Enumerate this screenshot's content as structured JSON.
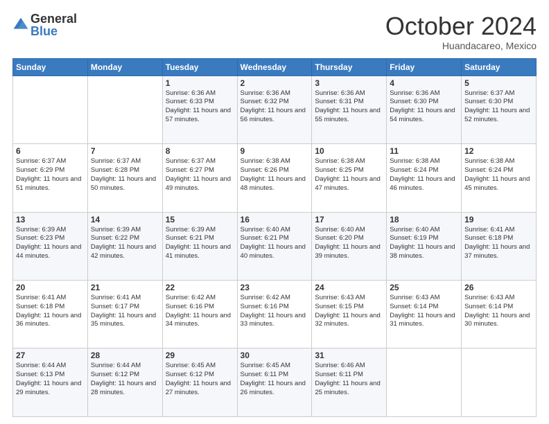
{
  "logo": {
    "general": "General",
    "blue": "Blue"
  },
  "title": "October 2024",
  "location": "Huandacareo, Mexico",
  "days_of_week": [
    "Sunday",
    "Monday",
    "Tuesday",
    "Wednesday",
    "Thursday",
    "Friday",
    "Saturday"
  ],
  "weeks": [
    [
      {
        "day": "",
        "sunrise": "",
        "sunset": "",
        "daylight": ""
      },
      {
        "day": "",
        "sunrise": "",
        "sunset": "",
        "daylight": ""
      },
      {
        "day": "1",
        "sunrise": "Sunrise: 6:36 AM",
        "sunset": "Sunset: 6:33 PM",
        "daylight": "Daylight: 11 hours and 57 minutes."
      },
      {
        "day": "2",
        "sunrise": "Sunrise: 6:36 AM",
        "sunset": "Sunset: 6:32 PM",
        "daylight": "Daylight: 11 hours and 56 minutes."
      },
      {
        "day": "3",
        "sunrise": "Sunrise: 6:36 AM",
        "sunset": "Sunset: 6:31 PM",
        "daylight": "Daylight: 11 hours and 55 minutes."
      },
      {
        "day": "4",
        "sunrise": "Sunrise: 6:36 AM",
        "sunset": "Sunset: 6:30 PM",
        "daylight": "Daylight: 11 hours and 54 minutes."
      },
      {
        "day": "5",
        "sunrise": "Sunrise: 6:37 AM",
        "sunset": "Sunset: 6:30 PM",
        "daylight": "Daylight: 11 hours and 52 minutes."
      }
    ],
    [
      {
        "day": "6",
        "sunrise": "Sunrise: 6:37 AM",
        "sunset": "Sunset: 6:29 PM",
        "daylight": "Daylight: 11 hours and 51 minutes."
      },
      {
        "day": "7",
        "sunrise": "Sunrise: 6:37 AM",
        "sunset": "Sunset: 6:28 PM",
        "daylight": "Daylight: 11 hours and 50 minutes."
      },
      {
        "day": "8",
        "sunrise": "Sunrise: 6:37 AM",
        "sunset": "Sunset: 6:27 PM",
        "daylight": "Daylight: 11 hours and 49 minutes."
      },
      {
        "day": "9",
        "sunrise": "Sunrise: 6:38 AM",
        "sunset": "Sunset: 6:26 PM",
        "daylight": "Daylight: 11 hours and 48 minutes."
      },
      {
        "day": "10",
        "sunrise": "Sunrise: 6:38 AM",
        "sunset": "Sunset: 6:25 PM",
        "daylight": "Daylight: 11 hours and 47 minutes."
      },
      {
        "day": "11",
        "sunrise": "Sunrise: 6:38 AM",
        "sunset": "Sunset: 6:24 PM",
        "daylight": "Daylight: 11 hours and 46 minutes."
      },
      {
        "day": "12",
        "sunrise": "Sunrise: 6:38 AM",
        "sunset": "Sunset: 6:24 PM",
        "daylight": "Daylight: 11 hours and 45 minutes."
      }
    ],
    [
      {
        "day": "13",
        "sunrise": "Sunrise: 6:39 AM",
        "sunset": "Sunset: 6:23 PM",
        "daylight": "Daylight: 11 hours and 44 minutes."
      },
      {
        "day": "14",
        "sunrise": "Sunrise: 6:39 AM",
        "sunset": "Sunset: 6:22 PM",
        "daylight": "Daylight: 11 hours and 42 minutes."
      },
      {
        "day": "15",
        "sunrise": "Sunrise: 6:39 AM",
        "sunset": "Sunset: 6:21 PM",
        "daylight": "Daylight: 11 hours and 41 minutes."
      },
      {
        "day": "16",
        "sunrise": "Sunrise: 6:40 AM",
        "sunset": "Sunset: 6:21 PM",
        "daylight": "Daylight: 11 hours and 40 minutes."
      },
      {
        "day": "17",
        "sunrise": "Sunrise: 6:40 AM",
        "sunset": "Sunset: 6:20 PM",
        "daylight": "Daylight: 11 hours and 39 minutes."
      },
      {
        "day": "18",
        "sunrise": "Sunrise: 6:40 AM",
        "sunset": "Sunset: 6:19 PM",
        "daylight": "Daylight: 11 hours and 38 minutes."
      },
      {
        "day": "19",
        "sunrise": "Sunrise: 6:41 AM",
        "sunset": "Sunset: 6:18 PM",
        "daylight": "Daylight: 11 hours and 37 minutes."
      }
    ],
    [
      {
        "day": "20",
        "sunrise": "Sunrise: 6:41 AM",
        "sunset": "Sunset: 6:18 PM",
        "daylight": "Daylight: 11 hours and 36 minutes."
      },
      {
        "day": "21",
        "sunrise": "Sunrise: 6:41 AM",
        "sunset": "Sunset: 6:17 PM",
        "daylight": "Daylight: 11 hours and 35 minutes."
      },
      {
        "day": "22",
        "sunrise": "Sunrise: 6:42 AM",
        "sunset": "Sunset: 6:16 PM",
        "daylight": "Daylight: 11 hours and 34 minutes."
      },
      {
        "day": "23",
        "sunrise": "Sunrise: 6:42 AM",
        "sunset": "Sunset: 6:16 PM",
        "daylight": "Daylight: 11 hours and 33 minutes."
      },
      {
        "day": "24",
        "sunrise": "Sunrise: 6:43 AM",
        "sunset": "Sunset: 6:15 PM",
        "daylight": "Daylight: 11 hours and 32 minutes."
      },
      {
        "day": "25",
        "sunrise": "Sunrise: 6:43 AM",
        "sunset": "Sunset: 6:14 PM",
        "daylight": "Daylight: 11 hours and 31 minutes."
      },
      {
        "day": "26",
        "sunrise": "Sunrise: 6:43 AM",
        "sunset": "Sunset: 6:14 PM",
        "daylight": "Daylight: 11 hours and 30 minutes."
      }
    ],
    [
      {
        "day": "27",
        "sunrise": "Sunrise: 6:44 AM",
        "sunset": "Sunset: 6:13 PM",
        "daylight": "Daylight: 11 hours and 29 minutes."
      },
      {
        "day": "28",
        "sunrise": "Sunrise: 6:44 AM",
        "sunset": "Sunset: 6:12 PM",
        "daylight": "Daylight: 11 hours and 28 minutes."
      },
      {
        "day": "29",
        "sunrise": "Sunrise: 6:45 AM",
        "sunset": "Sunset: 6:12 PM",
        "daylight": "Daylight: 11 hours and 27 minutes."
      },
      {
        "day": "30",
        "sunrise": "Sunrise: 6:45 AM",
        "sunset": "Sunset: 6:11 PM",
        "daylight": "Daylight: 11 hours and 26 minutes."
      },
      {
        "day": "31",
        "sunrise": "Sunrise: 6:46 AM",
        "sunset": "Sunset: 6:11 PM",
        "daylight": "Daylight: 11 hours and 25 minutes."
      },
      {
        "day": "",
        "sunrise": "",
        "sunset": "",
        "daylight": ""
      },
      {
        "day": "",
        "sunrise": "",
        "sunset": "",
        "daylight": ""
      }
    ]
  ]
}
